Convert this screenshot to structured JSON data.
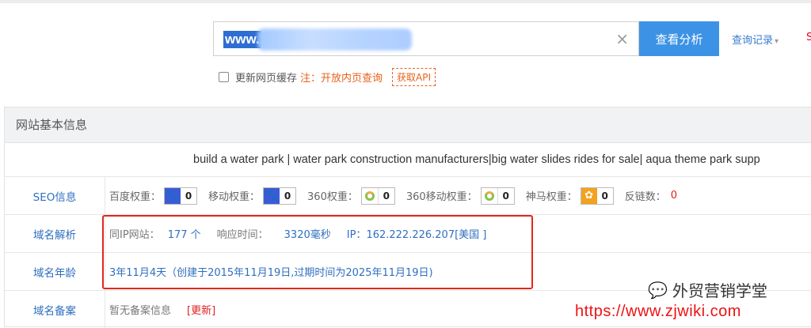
{
  "search": {
    "value": "www.",
    "clear_glyph": "×",
    "button_label": "查看分析",
    "history_label": "查询记录",
    "history_caret": "▾",
    "edge_text": "S"
  },
  "options": {
    "update_cache_label": "更新网页缓存",
    "note": "注：开放内页查询",
    "api_label": "获取API"
  },
  "panel": {
    "heading": "网站基本信息",
    "site_title": "build a water park | water park construction manufacturers|big water slides rides for sale| aqua theme park supp",
    "seo": {
      "label": "SEO信息",
      "items": [
        {
          "label": "百度权重：",
          "icon": "paw-icon",
          "value": "0"
        },
        {
          "label": "移动权重：",
          "icon": "paw-icon",
          "value": "0"
        },
        {
          "label": "360权重：",
          "icon": "ring-icon",
          "value": "0"
        },
        {
          "label": "360移动权重：",
          "icon": "ring-icon",
          "value": "0"
        },
        {
          "label": "神马权重：",
          "icon": "shenma-icon",
          "value": "0"
        }
      ],
      "backlinks_label": "反链数：",
      "backlinks_value": "0"
    },
    "dns": {
      "label": "域名解析",
      "same_ip_label": "同IP网站：",
      "same_ip_value": "177 个",
      "response_label": "响应时间：",
      "response_value": "3320毫秒",
      "ip_label": "IP：",
      "ip_value": "162.222.226.207[美国 ]"
    },
    "age": {
      "label": "域名年龄",
      "value": "3年11月4天（创建于2015年11月19日,过期时间为2025年11月19日)"
    },
    "icp": {
      "label": "域名备案",
      "value": "暂无备案信息",
      "update_label": "[更新]"
    }
  },
  "watermark": {
    "icon": "wechat-icon",
    "text": "外贸营销学堂",
    "url": "https://www.zjwiki.com"
  },
  "colors": {
    "accent": "#3c93e6",
    "link": "#2f6fbf",
    "highlight_frame": "#e3261b",
    "note": "#e8621a"
  }
}
